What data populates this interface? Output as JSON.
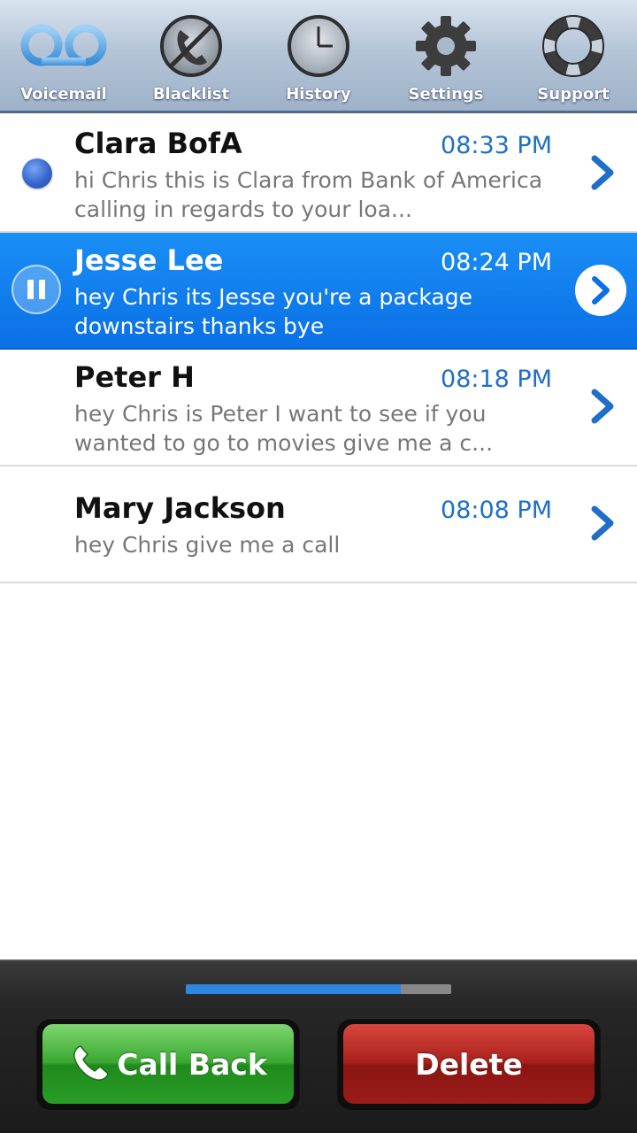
{
  "tabs": [
    {
      "label": "Voicemail",
      "icon": "voicemail-icon"
    },
    {
      "label": "Blacklist",
      "icon": "blacklist-phone-icon"
    },
    {
      "label": "History",
      "icon": "clock-icon"
    },
    {
      "label": "Settings",
      "icon": "gear-icon"
    },
    {
      "label": "Support",
      "icon": "lifebuoy-icon"
    }
  ],
  "voicemails": [
    {
      "name": "Clara BofA",
      "time": "08:33 PM",
      "preview": "hi Chris this is Clara from Bank of America calling in regards to your loa...",
      "state": "unread"
    },
    {
      "name": "Jesse Lee",
      "time": "08:24 PM",
      "preview": "hey Chris its Jesse you're a package downstairs thanks bye",
      "state": "playing"
    },
    {
      "name": "Peter H",
      "time": "08:18 PM",
      "preview": "hey Chris is Peter I want to see if you wanted to go to movies give me a c...",
      "state": "read"
    },
    {
      "name": "Mary Jackson",
      "time": "08:08 PM",
      "preview": "hey Chris give me a call",
      "state": "read"
    }
  ],
  "playback": {
    "progress": 0.81
  },
  "actions": {
    "callback_label": "Call Back",
    "delete_label": "Delete"
  },
  "colors": {
    "selected_row": "#0a70e6",
    "time_text": "#1f6fc9",
    "callback_green": "#2a9d26",
    "delete_red": "#9c1c19",
    "progress_blue": "#2f86de"
  }
}
